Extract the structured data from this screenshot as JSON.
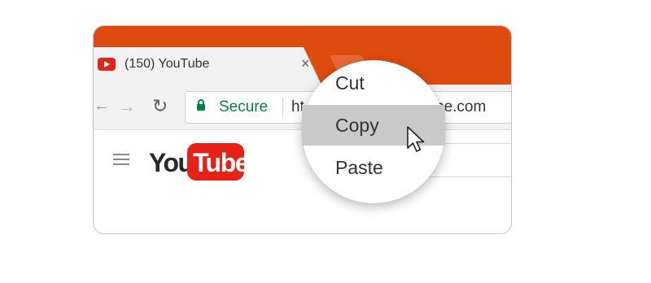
{
  "browser": {
    "tab": {
      "title": "(150) YouTube",
      "close_glyph": "×",
      "favicon": "youtube-favicon-icon"
    },
    "nav": {
      "back_glyph": "←",
      "forward_glyph": "→",
      "reload_glyph": "↻"
    },
    "omnibox": {
      "security_label": "Secure",
      "url_visible_start": "ht",
      "url_visible_end": "be.com"
    }
  },
  "page": {
    "hamburger": "menu-icon",
    "logo": {
      "you": "You",
      "tube": "Tube"
    }
  },
  "context_menu": {
    "items": [
      {
        "label": "Cut",
        "highlighted": false
      },
      {
        "label": "Copy",
        "highlighted": true
      },
      {
        "label": "Paste",
        "highlighted": false
      }
    ]
  },
  "colors": {
    "top_bar": "#de4b0f",
    "secure_green": "#0b8043",
    "youtube_red": "#e62117",
    "highlight": "#c9c9c9"
  }
}
